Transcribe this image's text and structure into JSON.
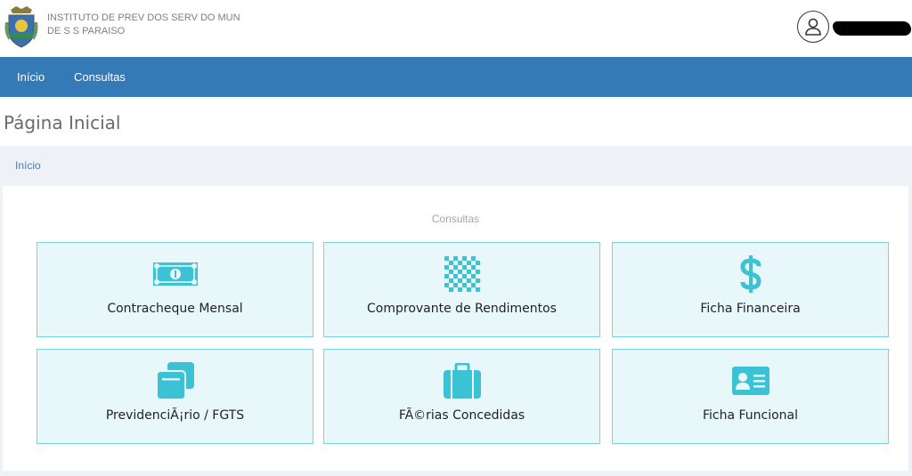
{
  "header": {
    "org_name": "INSTITUTO DE PREV DOS SERV DO MUN DE S S PARAISO"
  },
  "nav": {
    "items": [
      {
        "label": "Início"
      },
      {
        "label": "Consultas"
      }
    ]
  },
  "page": {
    "title": "Página Inicial",
    "breadcrumb": "Início"
  },
  "consultas": {
    "section_title": "Consultas",
    "cards": [
      {
        "label": "Contracheque Mensal",
        "icon": "money-bill-icon"
      },
      {
        "label": "Comprovante de Rendimentos",
        "icon": "checkerboard-icon"
      },
      {
        "label": "Ficha Financeira",
        "icon": "dollar-icon"
      },
      {
        "label": "PrevidenciÃ¡rio / FGTS",
        "icon": "clone-icon"
      },
      {
        "label": "FÃ©rias Concedidas",
        "icon": "suitcase-icon"
      },
      {
        "label": "Ficha Funcional",
        "icon": "id-card-icon"
      }
    ]
  },
  "colors": {
    "navbar": "#337ab7",
    "icon": "#3bc2d4",
    "card_bg": "#e8f8fa",
    "card_border": "#7ad3e0"
  }
}
